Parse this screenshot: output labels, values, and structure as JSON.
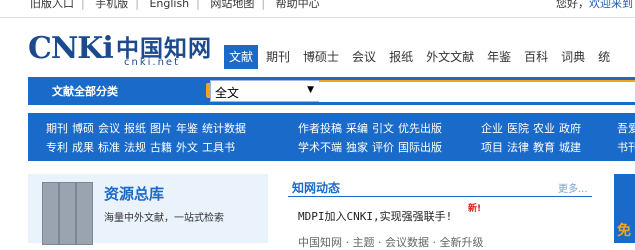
{
  "topbar": {
    "links": [
      "旧版入口",
      "手机版",
      "English",
      "网站地图",
      "帮助中心"
    ],
    "greeting": "您好，",
    "welcome": "欢迎来到"
  },
  "logo": {
    "en": "CNKi",
    "cn": "中国知网",
    "url": "cnki.net"
  },
  "tabs": [
    "文献",
    "期刊",
    "博硕士",
    "会议",
    "报纸",
    "外文文献",
    "年鉴",
    "百科",
    "词典",
    "统"
  ],
  "search": {
    "category_label": "文献全部分类",
    "scope_value": "全文",
    "query_value": ""
  },
  "catnav": {
    "group1": [
      [
        "期刊",
        "博硕",
        "会议",
        "报纸",
        "图片",
        "年鉴",
        "统计数据"
      ],
      [
        "专利",
        "成果",
        "标准",
        "法规",
        "古籍",
        "外文",
        "工具书"
      ]
    ],
    "group2": [
      [
        "作者投稿",
        "采编",
        "引文",
        "优先出版"
      ],
      [
        "学术不端",
        "独家",
        "评价",
        "国际出版"
      ]
    ],
    "group3": [
      [
        "企业",
        "医院",
        "农业",
        "政府"
      ],
      [
        "项目",
        "法律",
        "教育",
        "城建"
      ]
    ],
    "group4": [
      [
        "吾爱"
      ],
      [
        "书刊"
      ]
    ]
  },
  "resources": {
    "title": "资源总库",
    "subtitle": "海量中外文献，一站式检索"
  },
  "news": {
    "title": "知网动态",
    "more": "更多...",
    "badge": "新!",
    "item1": "MDPI加入CNKI,实现强强联手!",
    "item2": "中国知网 · 主题 · 会议数据 · 全新升级"
  },
  "side": {
    "badge_char": "免"
  },
  "colors": {
    "primary": "#1a6ac9",
    "accent": "#f4a41b",
    "new_badge": "#e0201e"
  }
}
